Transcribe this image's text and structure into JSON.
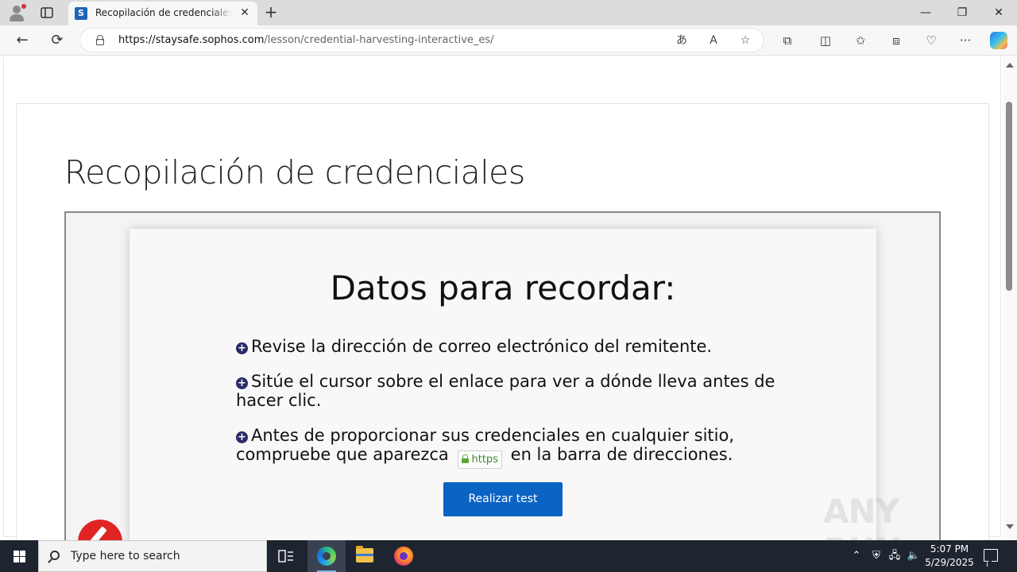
{
  "browser": {
    "tab_title": "Recopilación de credenciales – Sophos",
    "favicon_letter": "S",
    "url_host": "https://staysafe.sophos.com",
    "url_path": "/lesson/credential-harvesting-interactive_es/",
    "icons": {
      "back": "back-arrow-icon",
      "refresh": "refresh-icon",
      "translate": "translate-icon",
      "read_aloud": "read-aloud-icon",
      "favorite": "star-icon",
      "extensions": "puzzle-icon",
      "split": "split-screen-icon",
      "favorites": "favorites-icon",
      "collections": "collections-icon",
      "performance": "heart-pulse-icon",
      "more": "more-icon"
    }
  },
  "page": {
    "lesson_title": "Recopilación de credenciales",
    "tips_heading": "Datos para recordar:",
    "tips": [
      "Revise la dirección de correo electrónico del remitente.",
      "Sitúe el cursor sobre el enlace para ver a dónde lleva antes de hacer clic.",
      "Antes de proporcionar sus credenciales en cualquier sitio, compruebe que aparezca"
    ],
    "tip3_suffix": "en la barra de direcciones.",
    "https_badge": "https",
    "quiz_button": "Realizar test",
    "watermark": "ANY RUN"
  },
  "taskbar": {
    "search_placeholder": "Type here to search",
    "time": "5:07 PM",
    "date": "5/29/2025"
  },
  "colors": {
    "accent_button": "#0b63c4",
    "bullet": "#2b2b6b",
    "https_green": "#3a8a2c",
    "badge_red": "#e02424"
  }
}
